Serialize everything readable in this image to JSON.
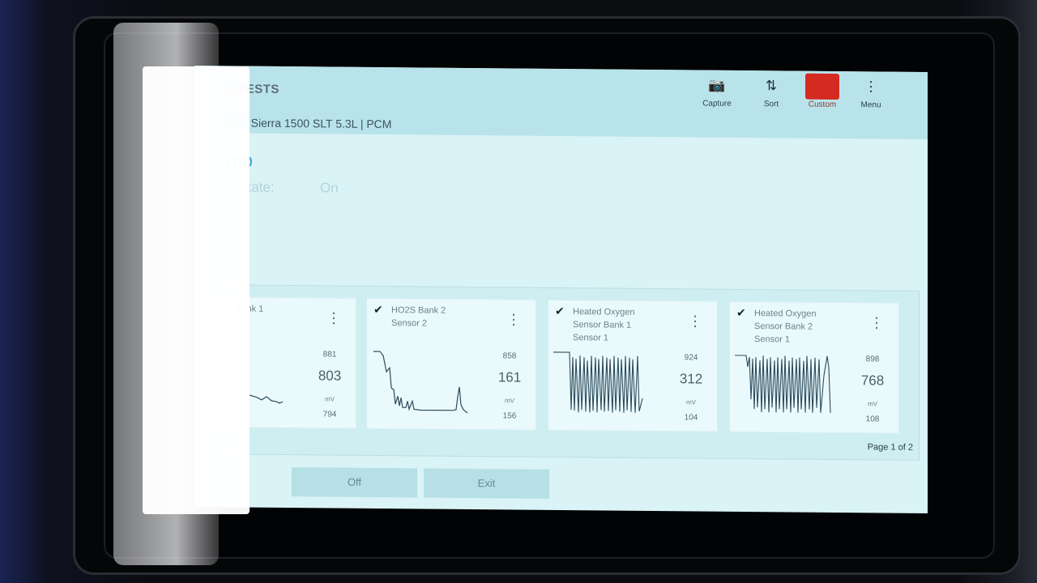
{
  "header": {
    "title": "L TESTS",
    "vehicle": "MC Sierra 1500 SLT 5.3L | PCM"
  },
  "toolbar": [
    {
      "name": "capture-button",
      "icon": "camera-icon",
      "glyph": "📷",
      "label": "Capture"
    },
    {
      "name": "sort-button",
      "icon": "sort-icon",
      "glyph": "⇅",
      "label": "Sort"
    },
    {
      "name": "custom-button",
      "icon": "custom-icon",
      "glyph": "",
      "label": "Custom"
    },
    {
      "name": "menu-button",
      "icon": "kebab-icon",
      "glyph": "⋮",
      "label": "Menu"
    }
  ],
  "test": {
    "name": "mp",
    "command_label": "d State:",
    "command_value": "On"
  },
  "cards": [
    {
      "name_lines": [
        "Bank 1",
        ""
      ],
      "max": "881",
      "current": "803",
      "unit": "mV",
      "min": "794"
    },
    {
      "name_lines": [
        "HO2S Bank 2",
        "Sensor 2"
      ],
      "max": "858",
      "current": "161",
      "unit": "mV",
      "min": "156"
    },
    {
      "name_lines": [
        "Heated Oxygen",
        "Sensor Bank 1",
        "Sensor 1"
      ],
      "max": "924",
      "current": "312",
      "unit": "mV",
      "min": "104"
    },
    {
      "name_lines": [
        "Heated Oxygen",
        "Sensor Bank 2",
        "Sensor 1"
      ],
      "max": "898",
      "current": "768",
      "unit": "mV",
      "min": "108"
    }
  ],
  "pagination": "Page 1 of 2",
  "buttons": {
    "off": "Off",
    "exit": "Exit"
  },
  "colors": {
    "accent": "#3aa6d6",
    "custom_red": "#d42a22",
    "screen_bg": "#d9f3f6"
  }
}
